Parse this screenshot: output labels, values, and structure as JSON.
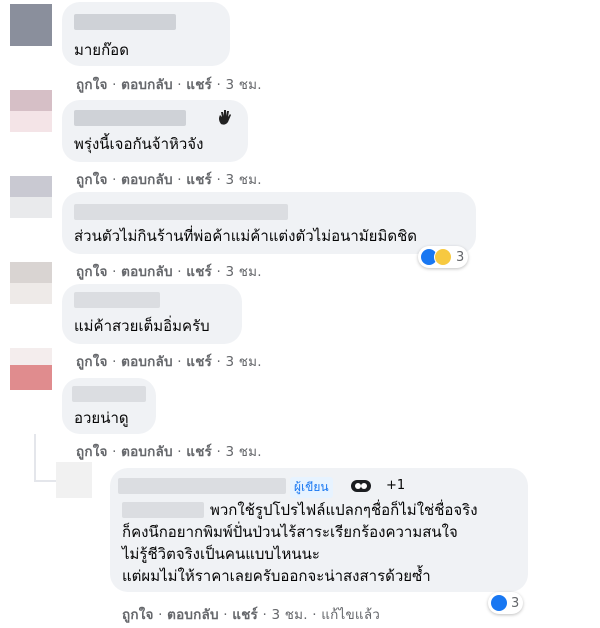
{
  "comments": [
    {
      "text": "มายก๊อด",
      "actions": {
        "like": "ถูกใจ",
        "reply": "ตอบกลับ",
        "share": "แชร์",
        "time": "3 ชม."
      }
    },
    {
      "text": "พรุ่งนี้เจอกันจ้าหิวจัง",
      "actions": {
        "like": "ถูกใจ",
        "reply": "ตอบกลับ",
        "share": "แชร์",
        "time": "3 ชม."
      }
    },
    {
      "text": "ส่วนตัวไม่กินร้านที่พ่อค้าแม่ค้าแต่งตัวไม่อนามัยมิดชิด",
      "actions": {
        "like": "ถูกใจ",
        "reply": "ตอบกลับ",
        "share": "แชร์",
        "time": "3 ชม."
      },
      "reaction_count": "3"
    },
    {
      "text": "แม่ค้าสวยเต็มอิ่มครับ",
      "actions": {
        "like": "ถูกใจ",
        "reply": "ตอบกลับ",
        "share": "แชร์",
        "time": "3 ชม."
      }
    },
    {
      "text": "อวยน่าดู",
      "actions": {
        "like": "ถูกใจ",
        "reply": "ตอบกลับ",
        "share": "แชร์",
        "time": "3 ชม."
      }
    }
  ],
  "reply": {
    "author_badge": "ผู้เขียน",
    "badge_plus": "+1",
    "lines": [
      "พวกใช้รูปโปรไฟล์แปลกๆชื่อก็ไม่ใช่ชื่อจริง",
      "ก็คงนึกอยากพิมพ์ปั่นป่วนไร้สาระเรียกร้องความสนใจ",
      "ไม่รู้ชีวิตจริงเป็นคนแบบไหนนะ",
      "แต่ผมไม่ให้ราคาเลยครับออกจะน่าสงสารด้วยซ้ำ"
    ],
    "actions": {
      "like": "ถูกใจ",
      "reply": "ตอบกลับ",
      "share": "แชร์",
      "time": "3 ชม.",
      "edited": "แก้ไขแล้ว"
    },
    "reaction_count": "3"
  },
  "colors": {
    "bubble": "#f0f2f5",
    "meta": "#65676b",
    "like_blue": "#1877f2"
  }
}
